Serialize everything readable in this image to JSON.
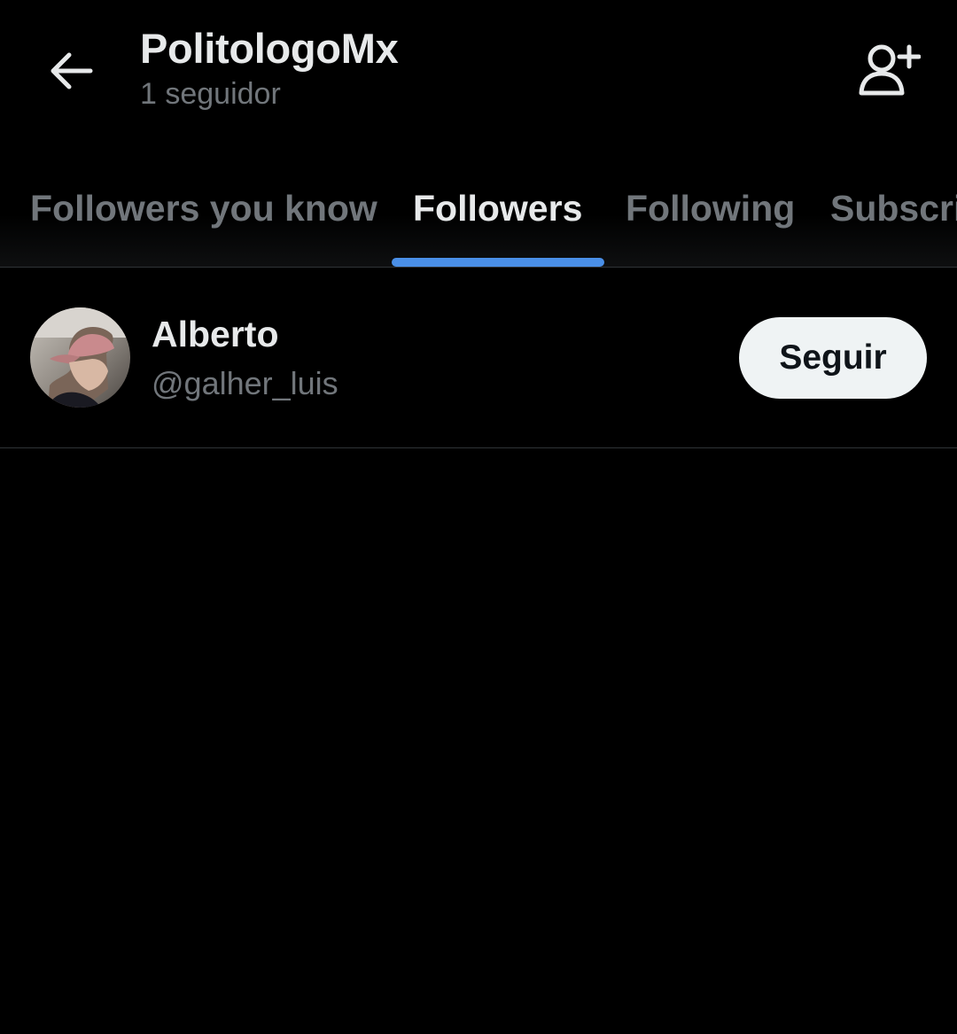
{
  "header": {
    "title": "PolitologoMx",
    "subtitle": "1 seguidor",
    "back_icon": "arrow-left-icon",
    "add_user_icon": "person-plus-icon"
  },
  "tabs": [
    {
      "label": "Followers you know",
      "active": false
    },
    {
      "label": "Followers",
      "active": true
    },
    {
      "label": "Following",
      "active": false
    },
    {
      "label": "Subscri",
      "active": false
    }
  ],
  "followers": [
    {
      "name": "Alberto",
      "handle": "@galher_luis",
      "follow_label": "Seguir"
    }
  ],
  "colors": {
    "background": "#000000",
    "primary_text": "#e7e9ea",
    "secondary_text": "#71767b",
    "accent": "#4a8fe7",
    "divider": "#2f3336",
    "button_bg": "#eff3f4"
  }
}
